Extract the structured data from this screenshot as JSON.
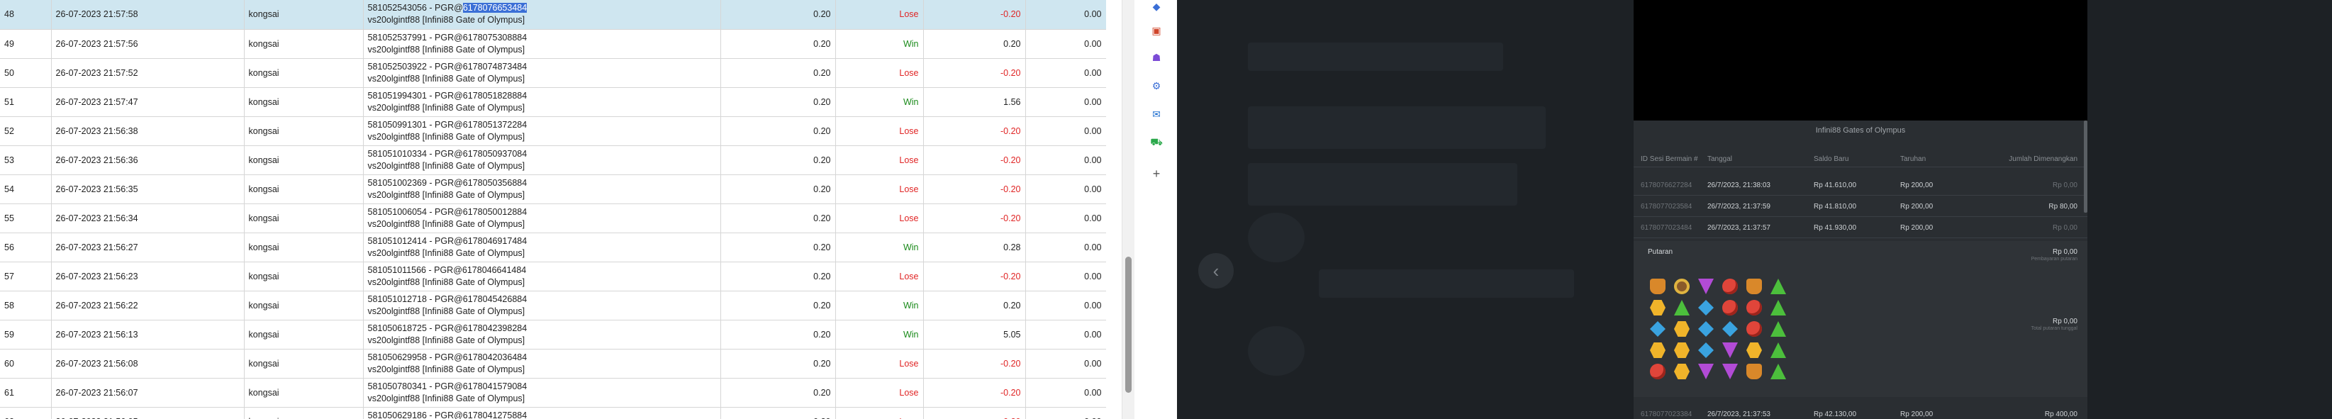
{
  "table": {
    "rows": [
      {
        "no": "48",
        "datetime": "26-07-2023 21:57:58",
        "user": "kongsai",
        "game_id_prefix": "581052543056 - PGR@",
        "game_id_hl": "6178076653484",
        "game_line2": "vs20olgintf88 [Infini88 Gate of Olympus]",
        "bet": "0.20",
        "result": "Lose",
        "winloss": "-0.20",
        "balance": "0.00",
        "selected": true
      },
      {
        "no": "49",
        "datetime": "26-07-2023 21:57:56",
        "user": "kongsai",
        "game_id_prefix": "581052537991 - PGR@6178075308884",
        "game_id_hl": "",
        "game_line2": "vs20olgintf88 [Infini88 Gate of Olympus]",
        "bet": "0.20",
        "result": "Win",
        "winloss": "0.20",
        "balance": "0.00"
      },
      {
        "no": "50",
        "datetime": "26-07-2023 21:57:52",
        "user": "kongsai",
        "game_id_prefix": "581052503922 - PGR@6178074873484",
        "game_id_hl": "",
        "game_line2": "vs20olgintf88 [Infini88 Gate of Olympus]",
        "bet": "0.20",
        "result": "Lose",
        "winloss": "-0.20",
        "balance": "0.00"
      },
      {
        "no": "51",
        "datetime": "26-07-2023 21:57:47",
        "user": "kongsai",
        "game_id_prefix": "581051994301 - PGR@6178051828884",
        "game_id_hl": "",
        "game_line2": "vs20olgintf88 [Infini88 Gate of Olympus]",
        "bet": "0.20",
        "result": "Win",
        "winloss": "1.56",
        "balance": "0.00"
      },
      {
        "no": "52",
        "datetime": "26-07-2023 21:56:38",
        "user": "kongsai",
        "game_id_prefix": "581050991301 - PGR@6178051372284",
        "game_id_hl": "",
        "game_line2": "vs20olgintf88 [Infini88 Gate of Olympus]",
        "bet": "0.20",
        "result": "Lose",
        "winloss": "-0.20",
        "balance": "0.00"
      },
      {
        "no": "53",
        "datetime": "26-07-2023 21:56:36",
        "user": "kongsai",
        "game_id_prefix": "581051010334 - PGR@6178050937084",
        "game_id_hl": "",
        "game_line2": "vs20olgintf88 [Infini88 Gate of Olympus]",
        "bet": "0.20",
        "result": "Lose",
        "winloss": "-0.20",
        "balance": "0.00"
      },
      {
        "no": "54",
        "datetime": "26-07-2023 21:56:35",
        "user": "kongsai",
        "game_id_prefix": "581051002369 - PGR@6178050356884",
        "game_id_hl": "",
        "game_line2": "vs20olgintf88 [Infini88 Gate of Olympus]",
        "bet": "0.20",
        "result": "Lose",
        "winloss": "-0.20",
        "balance": "0.00"
      },
      {
        "no": "55",
        "datetime": "26-07-2023 21:56:34",
        "user": "kongsai",
        "game_id_prefix": "581051006054 - PGR@6178050012884",
        "game_id_hl": "",
        "game_line2": "vs20olgintf88 [Infini88 Gate of Olympus]",
        "bet": "0.20",
        "result": "Lose",
        "winloss": "-0.20",
        "balance": "0.00"
      },
      {
        "no": "56",
        "datetime": "26-07-2023 21:56:27",
        "user": "kongsai",
        "game_id_prefix": "581051012414 - PGR@6178046917484",
        "game_id_hl": "",
        "game_line2": "vs20olgintf88 [Infini88 Gate of Olympus]",
        "bet": "0.20",
        "result": "Win",
        "winloss": "0.28",
        "balance": "0.00"
      },
      {
        "no": "57",
        "datetime": "26-07-2023 21:56:23",
        "user": "kongsai",
        "game_id_prefix": "581051011566 - PGR@6178046641484",
        "game_id_hl": "",
        "game_line2": "vs20olgintf88 [Infini88 Gate of Olympus]",
        "bet": "0.20",
        "result": "Lose",
        "winloss": "-0.20",
        "balance": "0.00"
      },
      {
        "no": "58",
        "datetime": "26-07-2023 21:56:22",
        "user": "kongsai",
        "game_id_prefix": "581051012718 - PGR@6178045426884",
        "game_id_hl": "",
        "game_line2": "vs20olgintf88 [Infini88 Gate of Olympus]",
        "bet": "0.20",
        "result": "Win",
        "winloss": "0.20",
        "balance": "0.00"
      },
      {
        "no": "59",
        "datetime": "26-07-2023 21:56:13",
        "user": "kongsai",
        "game_id_prefix": "581050618725 - PGR@6178042398284",
        "game_id_hl": "",
        "game_line2": "vs20olgintf88 [Infini88 Gate of Olympus]",
        "bet": "0.20",
        "result": "Win",
        "winloss": "5.05",
        "balance": "0.00"
      },
      {
        "no": "60",
        "datetime": "26-07-2023 21:56:08",
        "user": "kongsai",
        "game_id_prefix": "581050629958 - PGR@6178042036484",
        "game_id_hl": "",
        "game_line2": "vs20olgintf88 [Infini88 Gate of Olympus]",
        "bet": "0.20",
        "result": "Lose",
        "winloss": "-0.20",
        "balance": "0.00"
      },
      {
        "no": "61",
        "datetime": "26-07-2023 21:56:07",
        "user": "kongsai",
        "game_id_prefix": "581050780341 - PGR@6178041579084",
        "game_id_hl": "",
        "game_line2": "vs20olgintf88 [Infini88 Gate of Olympus]",
        "bet": "0.20",
        "result": "Lose",
        "winloss": "-0.20",
        "balance": "0.00"
      },
      {
        "no": "62",
        "datetime": "26-07-2023 21:56:05",
        "user": "kongsai",
        "game_id_prefix": "581050629186 - PGR@6178041275884",
        "game_id_hl": "",
        "game_line2": "vs20olgintf88 [Infini88 Gate of Olympus]",
        "bet": "0.20",
        "result": "Lose",
        "winloss": "-0.20",
        "balance": "0.00"
      }
    ]
  },
  "extension_icons": [
    "diamond-icon",
    "toolbox-icon",
    "users-icon",
    "gear-icon",
    "outlook-icon",
    "cart-icon",
    "plus-icon"
  ],
  "history": {
    "title": "Infini88 Gates of Olympus",
    "headers": {
      "id": "ID Sesi Bermain #",
      "date": "Tanggal",
      "saldo": "Saldo Baru",
      "taruhan": "Taruhan",
      "menang": "Jumlah Dimenangkan"
    },
    "rows": [
      {
        "id": "6178076627284",
        "date": "26/7/2023, 21:38:03",
        "saldo": "Rp 41.610,00",
        "taruhan": "Rp 200,00",
        "menang": "Rp 0,00"
      },
      {
        "id": "6178077023584",
        "date": "26/7/2023, 21:37:59",
        "saldo": "Rp 41.810,00",
        "taruhan": "Rp 200,00",
        "menang": "Rp 80,00"
      },
      {
        "id": "6178077023484",
        "date": "26/7/2023, 21:37:57",
        "saldo": "Rp 41.930,00",
        "taruhan": "Rp 200,00",
        "menang": "Rp 0,00"
      }
    ],
    "detail": {
      "label": "Putaran",
      "value": "Rp 0,00",
      "sub": "Pembayaran putaran",
      "value2": "Rp 0,00",
      "sub2": "Total putaran tunggal"
    },
    "bottom_row": {
      "id": "6178077023384",
      "date": "26/7/2023, 21:37:53",
      "saldo": "Rp 42.130,00",
      "taruhan": "Rp 200,00",
      "menang": "Rp 400,00"
    },
    "grid": [
      [
        "cup",
        "ring",
        "purple",
        "red",
        "cup",
        "green"
      ],
      [
        "yellow",
        "green",
        "blue",
        "red",
        "red",
        "green"
      ],
      [
        "blue",
        "yellow",
        "blue",
        "blue",
        "red",
        "green"
      ],
      [
        "yellow",
        "yellow",
        "blue",
        "purple",
        "yellow",
        "green"
      ],
      [
        "red",
        "yellow",
        "purple",
        "purple",
        "cup",
        "green"
      ]
    ]
  }
}
